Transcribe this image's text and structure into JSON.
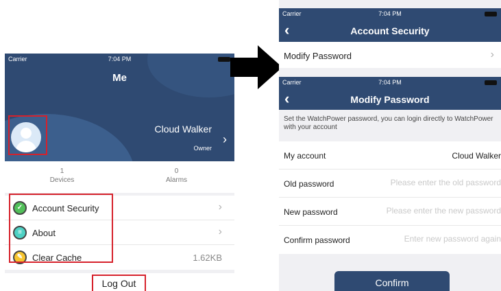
{
  "status_bar": {
    "carrier": "Carrier",
    "time": "7:04 PM"
  },
  "me": {
    "title": "Me",
    "user_name": "Cloud Walker",
    "user_role": "Owner",
    "stats": [
      {
        "count": "1",
        "label": "Devices"
      },
      {
        "count": "0",
        "label": "Alarms"
      }
    ],
    "menu": [
      {
        "label": "Account Security",
        "icon": "shield-icon"
      },
      {
        "label": "About",
        "icon": "info-list-icon"
      },
      {
        "label": "Clear Cache",
        "icon": "broom-icon",
        "value": "1.62KB"
      }
    ],
    "logout_label": "Log Out"
  },
  "account_security": {
    "title": "Account Security",
    "modify_password_label": "Modify Password"
  },
  "modify_password": {
    "title": "Modify Password",
    "note": "Set the WatchPower password, you can login directly to WatchPower with your account",
    "my_account_label": "My account",
    "my_account_value": "Cloud Walker",
    "old_password_label": "Old password",
    "old_password_placeholder": "Please enter the old password",
    "new_password_label": "New password",
    "new_password_placeholder": "Please enter the new password",
    "confirm_password_label": "Confirm password",
    "confirm_password_placeholder": "Enter new password again",
    "confirm_button": "Confirm"
  },
  "colors": {
    "nav": "#2f4a72",
    "highlight": "#d6212b",
    "arrow": "#000000"
  }
}
